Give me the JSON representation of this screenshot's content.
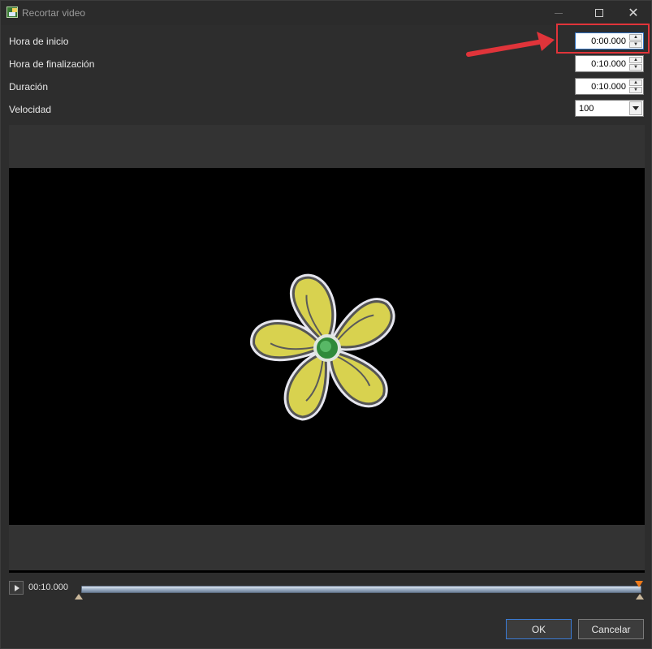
{
  "window": {
    "title": "Recortar video"
  },
  "form": {
    "start_label": "Hora de inicio",
    "start_value": "0:00.000",
    "end_label": "Hora de finalización",
    "end_value": "0:10.000",
    "duration_label": "Duración",
    "duration_value": "0:10.000",
    "speed_label": "Velocidad",
    "speed_value": "100"
  },
  "timeline": {
    "time": "00:10.000",
    "position_fraction": 1.0
  },
  "buttons": {
    "ok": "OK",
    "cancel": "Cancelar"
  },
  "colors": {
    "highlight": "#e0343a",
    "accent": "#3a7bd5"
  },
  "icons": {
    "app": "video-trim-app-icon",
    "minimize": "minimize-icon",
    "maximize": "maximize-icon",
    "close": "close-icon",
    "play": "play-icon",
    "annotation": "red-arrow-icon"
  }
}
